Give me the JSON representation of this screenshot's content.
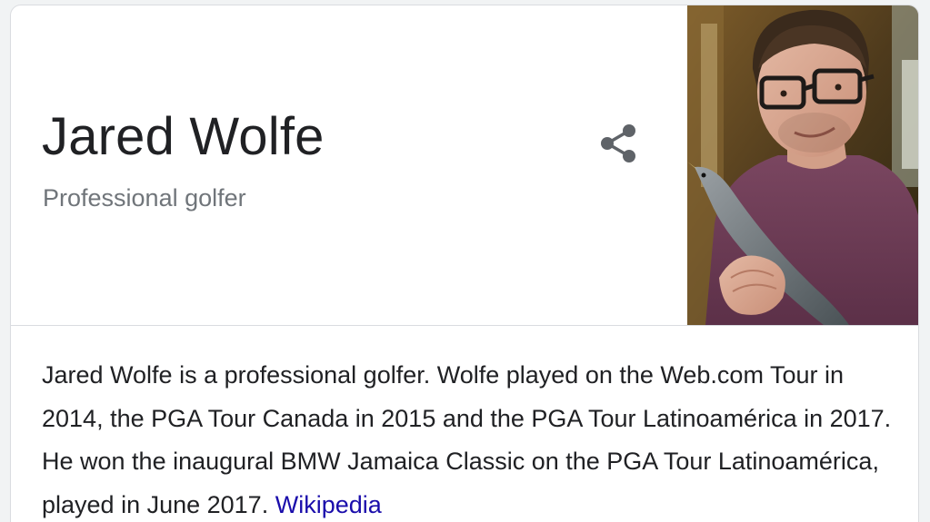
{
  "knowledge_panel": {
    "title": "Jared Wolfe",
    "subtitle": "Professional golfer",
    "share_icon": "share-icon",
    "photo_icon": "person-photo",
    "description": "Jared Wolfe is a professional golfer. Wolfe played on the Web.com Tour in 2014, the PGA Tour Canada in 2015 and the PGA Tour Latinoamérica in 2017. He won the inaugural BMW Jamaica Classic on the PGA Tour Latinoamérica, played in June 2017.",
    "source_link": "Wikipedia"
  },
  "colors": {
    "title": "#202124",
    "subtitle": "#70757a",
    "link": "#1a0dab",
    "border": "#dadce0",
    "icon": "#5f6368"
  }
}
